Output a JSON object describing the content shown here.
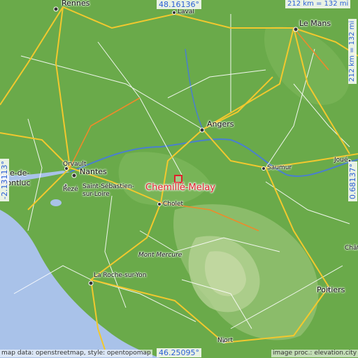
{
  "colors": {
    "lowland": "#6aaa4a",
    "upland": "#7fb85c",
    "hill": "#a9c98a",
    "sea": "#a9c2e9",
    "river": "#4a7fcf",
    "major_road": "#f2c82e",
    "minor_road": "#ffffff",
    "label_blue": "#2a5fd6",
    "target_red": "#e0212b"
  },
  "coordinates": {
    "top": "48.16136°",
    "bottom": "46.25095°",
    "left": "-2.13113°",
    "right": "0.68137°"
  },
  "scale": {
    "horizontal": "212 km = 132 mi",
    "vertical": "212 km = 132 mi"
  },
  "target": {
    "name": "Chemillé-Melay",
    "icon": "square-marker-icon"
  },
  "cities": [
    {
      "key": "rennes",
      "label": "Rennes"
    },
    {
      "key": "laval",
      "label": "Laval"
    },
    {
      "key": "le-mans",
      "label": "Le Mans"
    },
    {
      "key": "angers",
      "label": "Angers"
    },
    {
      "key": "saumur",
      "label": "Saumur"
    },
    {
      "key": "orvault",
      "label": "Orvault"
    },
    {
      "key": "nantes",
      "label": "Nantes"
    },
    {
      "key": "reze",
      "label": "Rezé"
    },
    {
      "key": "saint-sebastien-1",
      "label": "Saint-Sébastien-"
    },
    {
      "key": "saint-sebastien-2",
      "label": "sur-Loire"
    },
    {
      "key": "cholet",
      "label": "Cholet"
    },
    {
      "key": "joue",
      "label": "Joué"
    },
    {
      "key": "montluc-1",
      "label": "nne-de-"
    },
    {
      "key": "montluc-2",
      "label": "Montluc"
    },
    {
      "key": "mont-mercure",
      "label": "Mont Mercure"
    },
    {
      "key": "la-roche",
      "label": "La Roche-sur-Yon"
    },
    {
      "key": "poitiers",
      "label": "Poitiers"
    },
    {
      "key": "niort",
      "label": "Niort"
    },
    {
      "key": "chat",
      "label": "Chât"
    }
  ],
  "credits": {
    "left": "map data: openstreetmap, style: opentopomap",
    "right": "image proc.: elevation.city"
  }
}
